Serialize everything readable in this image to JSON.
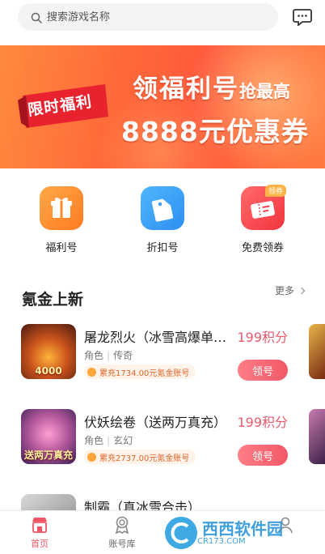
{
  "search": {
    "placeholder": "搜索游戏名称"
  },
  "banner": {
    "ribbon": "限时福利",
    "line1_main": "领福利号",
    "line1_small": "抢最高",
    "line2": "8888元优惠券"
  },
  "quick": [
    {
      "label": "福利号",
      "icon": "gift-icon"
    },
    {
      "label": "折扣号",
      "icon": "price-tag-icon"
    },
    {
      "label": "免费领券",
      "icon": "ticket-icon",
      "tag": "领券"
    }
  ],
  "section": {
    "title": "氪金上新",
    "more": "更多"
  },
  "games": [
    {
      "name": "屠龙烈火（冰雪高爆单职业）",
      "tags": [
        "角色",
        "传奇"
      ],
      "badge": "累充1734.00元氪金账号",
      "price": "199积分",
      "button": "领号",
      "thumb_caption": "4000"
    },
    {
      "name": "伏妖绘卷（送两万真充）",
      "tags": [
        "角色",
        "玄幻"
      ],
      "badge": "累充2737.00元氪金账号",
      "price": "199积分",
      "button": "领号",
      "thumb_caption": "送两万真充"
    },
    {
      "name": "制霸（真冰雪合击）",
      "tags": [],
      "badge": "",
      "price": "",
      "button": "",
      "thumb_caption": ""
    }
  ],
  "tabs": [
    {
      "label": "首页",
      "active": true
    },
    {
      "label": "账号库",
      "active": false
    },
    {
      "label": "",
      "active": false
    }
  ],
  "watermark": {
    "brand": "西西软件园",
    "url": "CR173.COM"
  },
  "colors": {
    "accent": "#f05663",
    "price": "#e85b6d",
    "banner": "#ff6a3a"
  }
}
